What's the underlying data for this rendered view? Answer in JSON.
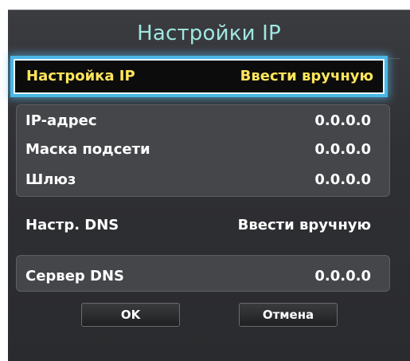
{
  "dialog": {
    "title": "Настройки IP"
  },
  "ip_setting": {
    "label": "Настройка IP",
    "value": "Ввести вручную"
  },
  "ip_group": [
    {
      "label": "IP-адрес",
      "value": "0.0.0.0"
    },
    {
      "label": "Маска подсети",
      "value": "0.0.0.0"
    },
    {
      "label": "Шлюз",
      "value": "0.0.0.0"
    }
  ],
  "dns_setting": {
    "label": "Настр. DNS",
    "value": "Ввести вручную"
  },
  "dns_server": {
    "label": "Сервер DNS",
    "value": "0.0.0.0"
  },
  "buttons": {
    "ok": "OK",
    "cancel": "Отмена"
  },
  "colors": {
    "title": "#9fe7e1",
    "focus_text": "#ffe65a",
    "focus_glow": "#4ab7e6",
    "panel": "#2f3034",
    "group_box": "#45464a"
  }
}
